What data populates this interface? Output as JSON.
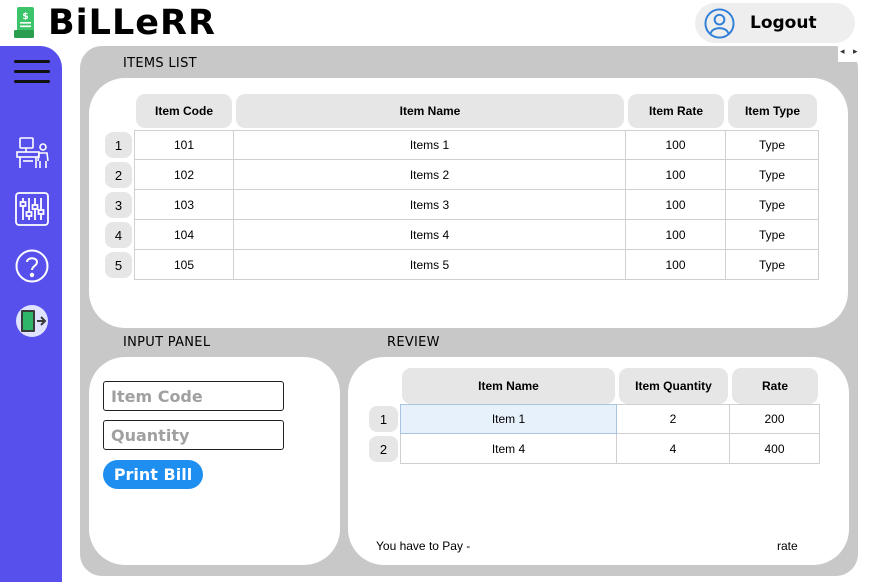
{
  "app": {
    "title": "BiLLeRR",
    "logo_icon": "receipt-dollar-icon"
  },
  "header": {
    "logout_label": "Logout",
    "logout_icon": "user-circle-icon"
  },
  "sidebar": {
    "color": "#5850ec",
    "items": [
      {
        "icon": "menu-icon"
      },
      {
        "icon": "cashier-desk-icon"
      },
      {
        "icon": "sliders-icon"
      },
      {
        "icon": "help-icon"
      },
      {
        "icon": "exit-door-icon"
      }
    ]
  },
  "items_list": {
    "title": "ITEMS LIST",
    "columns": [
      "Item Code",
      "Item Name",
      "Item Rate",
      "Item Type"
    ],
    "rows": [
      {
        "num": "1",
        "cells": [
          "101",
          "Items 1",
          "100",
          "Type"
        ]
      },
      {
        "num": "2",
        "cells": [
          "102",
          "Items 2",
          "100",
          "Type"
        ]
      },
      {
        "num": "3",
        "cells": [
          "103",
          "Items 3",
          "100",
          "Type"
        ]
      },
      {
        "num": "4",
        "cells": [
          "104",
          "Items 4",
          "100",
          "Type"
        ]
      },
      {
        "num": "5",
        "cells": [
          "105",
          "Items 5",
          "100",
          "Type"
        ]
      }
    ]
  },
  "input_panel": {
    "title": "INPUT PANEL",
    "item_code_placeholder": "Item Code",
    "quantity_placeholder": "Quantity",
    "print_label": "Print Bill",
    "print_color": "#1f8ef1"
  },
  "review": {
    "title": "REVIEW",
    "columns": [
      "Item Name",
      "Item Quantity",
      "Rate"
    ],
    "rows": [
      {
        "num": "1",
        "cells": [
          "Item 1",
          "2",
          "200"
        ]
      },
      {
        "num": "2",
        "cells": [
          "Item 4",
          "4",
          "400"
        ]
      }
    ],
    "pay_label": "You have to Pay -",
    "pay_value": "rate"
  }
}
